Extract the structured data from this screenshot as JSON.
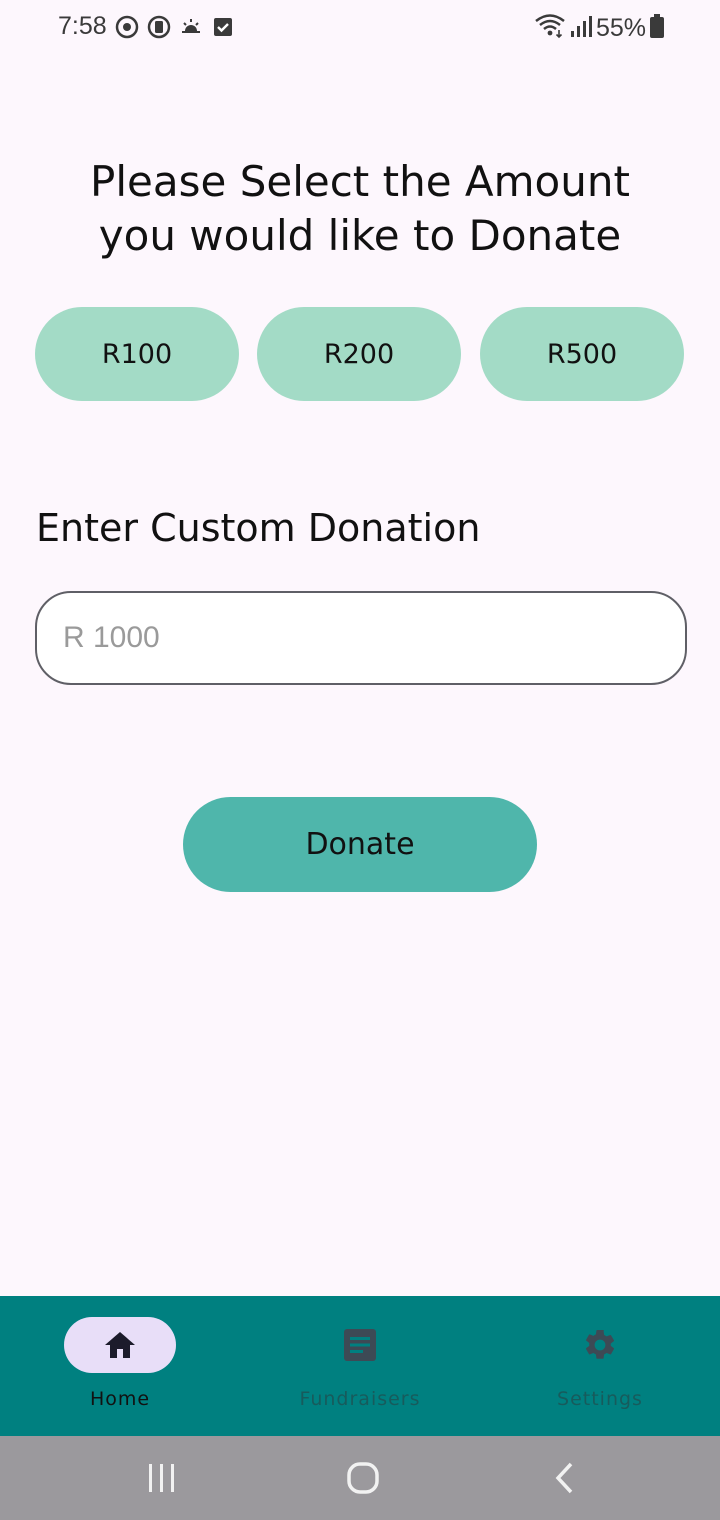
{
  "status_bar": {
    "time": "7:58",
    "battery": "55%",
    "left_icons": [
      "sync-icon",
      "media-icon",
      "weather-icon",
      "checkbox-icon"
    ],
    "right_icons": [
      "wifi-icon",
      "signal-icon",
      "battery-icon"
    ]
  },
  "headline": {
    "line1": "Please Select the Amount",
    "line2": "you would like to Donate"
  },
  "presets": [
    {
      "label": "R100"
    },
    {
      "label": "R200"
    },
    {
      "label": "R500"
    }
  ],
  "custom": {
    "label": "Enter Custom Donation",
    "placeholder": "R 1000",
    "value": ""
  },
  "donate_label": "Donate",
  "bottom_nav": {
    "items": [
      {
        "label": "Home",
        "icon": "home-icon",
        "selected": true
      },
      {
        "label": "Fundraisers",
        "icon": "document-icon",
        "selected": false
      },
      {
        "label": "Settings",
        "icon": "gear-icon",
        "selected": false
      }
    ]
  },
  "system_nav": {
    "buttons": [
      "recents-icon",
      "home-circle-icon",
      "back-icon"
    ]
  },
  "colors": {
    "background": "#fdf7fd",
    "preset_button": "#a3dbc6",
    "donate_button": "#4fb6ab",
    "nav_bar": "#008080",
    "nav_pill": "#e8def8",
    "system_bar": "#9b999d"
  }
}
